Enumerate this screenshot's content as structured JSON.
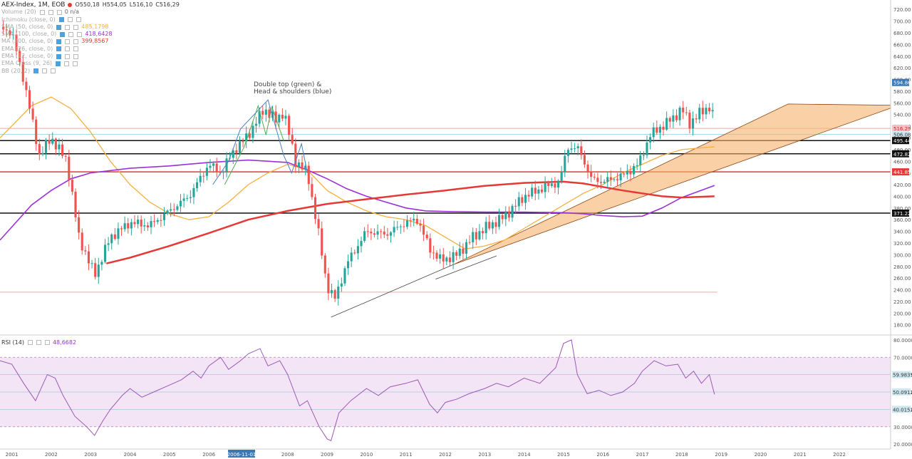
{
  "header": {
    "symbol": "AEX-Index, 1M, EOB",
    "open": "O550,18",
    "high": "H554,05",
    "low": "L516,10",
    "close": "C516,29"
  },
  "indicators": [
    {
      "label": "Volume (20)",
      "value": "0  n/a",
      "color": "#666666"
    },
    {
      "label": "Ichimoku (close, 0)",
      "value": "",
      "color": "#aaaaaa"
    },
    {
      "label": "SMA (50, close, 0)",
      "value": "485,1798",
      "color": "#f5b041"
    },
    {
      "label": "SMA (100, close, 0)",
      "value": "418,6428",
      "color": "#9b30d9"
    },
    {
      "label": "MA (200, close, 0)",
      "value": "399,8567",
      "color": "#e53935"
    },
    {
      "label": "EMA (26, close, 0)",
      "value": "",
      "color": "#aaaaaa"
    },
    {
      "label": "EMA (12, close, 0)",
      "value": "",
      "color": "#aaaaaa"
    },
    {
      "label": "EMA Cross (9, 26)",
      "value": "",
      "color": "#aaaaaa"
    },
    {
      "label": "BB (20, 2)",
      "value": "",
      "color": "#aaaaaa"
    }
  ],
  "annotation": [
    "Double top (green) &",
    "Head & shoulders (blue)"
  ],
  "rsi": {
    "label": "RSI (14)",
    "value": "48,6682"
  },
  "chart_data": {
    "type": "candlestick",
    "price_axis": {
      "ylim": [
        165,
        730
      ],
      "ticks": [
        "720.00",
        "700.00",
        "680.00",
        "660.00",
        "640.00",
        "620.00",
        "600.00",
        "580.00",
        "560.00",
        "540.00",
        "520.00",
        "500.00",
        "480.00",
        "460.00",
        "440.00",
        "420.00",
        "400.00",
        "380.00",
        "360.00",
        "340.00",
        "320.00",
        "300.00",
        "280.00",
        "260.00",
        "240.00",
        "220.00",
        "200.00",
        "180.00"
      ]
    },
    "price_labels": [
      {
        "value": 594.86,
        "text": "594.86",
        "bg": "#3c78b4",
        "fg": "#ffffff"
      },
      {
        "value": 516.29,
        "text": "516.29",
        "bg": "#f3c4c4",
        "fg": "#c62828"
      },
      {
        "value": 506.08,
        "text": "506.08",
        "bg": "#cfe8f0",
        "fg": "#333333"
      },
      {
        "value": 495.44,
        "text": "495.44",
        "bg": "#111111",
        "fg": "#ffffff"
      },
      {
        "value": 472.82,
        "text": "472.82",
        "bg": "#111111",
        "fg": "#ffffff"
      },
      {
        "value": 441.85,
        "text": "441.85",
        "bg": "#e53935",
        "fg": "#ffffff"
      },
      {
        "value": 371.22,
        "text": "371.22",
        "bg": "#111111",
        "fg": "#ffffff"
      }
    ],
    "horizontal_lines": [
      {
        "value": 516.29,
        "color": "#f2a8a8",
        "width": 1
      },
      {
        "value": 506.08,
        "color": "#a8d8e8",
        "width": 1
      },
      {
        "value": 495.44,
        "color": "#111111",
        "width": 1.5
      },
      {
        "value": 472.82,
        "color": "#111111",
        "width": 1.5
      },
      {
        "value": 441.85,
        "color": "#e53935",
        "width": 1.5
      },
      {
        "value": 371.22,
        "color": "#111111",
        "width": 1.5
      },
      {
        "value": 236,
        "color": "#f2a8a8",
        "width": 1
      }
    ],
    "x_axis": {
      "labels": [
        "2001",
        "2002",
        "2003",
        "2004",
        "2005",
        "2006",
        "2007",
        "2008",
        "2009",
        "2010",
        "2011",
        "2012",
        "2013",
        "2014",
        "2015",
        "2016",
        "2017",
        "2018",
        "2019",
        "2020",
        "2021",
        "2022"
      ],
      "range": [
        2000.7,
        2023.3
      ],
      "highlight": {
        "text": "2006-11-01",
        "year": 2006.83
      }
    },
    "close_anchors": [
      [
        2000.7,
        690
      ],
      [
        2001.0,
        680
      ],
      [
        2001.3,
        600
      ],
      [
        2001.7,
        470
      ],
      [
        2002.0,
        500
      ],
      [
        2002.4,
        460
      ],
      [
        2002.7,
        330
      ],
      [
        2003.1,
        265
      ],
      [
        2003.5,
        330
      ],
      [
        2004.0,
        355
      ],
      [
        2004.5,
        350
      ],
      [
        2005.0,
        375
      ],
      [
        2005.5,
        400
      ],
      [
        2006.0,
        455
      ],
      [
        2006.3,
        440
      ],
      [
        2006.6,
        475
      ],
      [
        2007.0,
        505
      ],
      [
        2007.4,
        550
      ],
      [
        2007.7,
        530
      ],
      [
        2007.9,
        545
      ],
      [
        2008.2,
        460
      ],
      [
        2008.5,
        440
      ],
      [
        2008.8,
        330
      ],
      [
        2009.0,
        245
      ],
      [
        2009.2,
        225
      ],
      [
        2009.5,
        285
      ],
      [
        2010.0,
        340
      ],
      [
        2010.5,
        335
      ],
      [
        2011.0,
        355
      ],
      [
        2011.3,
        360
      ],
      [
        2011.6,
        310
      ],
      [
        2011.9,
        290
      ],
      [
        2012.3,
        300
      ],
      [
        2012.7,
        330
      ],
      [
        2013.0,
        345
      ],
      [
        2013.5,
        365
      ],
      [
        2014.0,
        400
      ],
      [
        2014.5,
        415
      ],
      [
        2014.9,
        425
      ],
      [
        2015.1,
        485
      ],
      [
        2015.4,
        480
      ],
      [
        2015.7,
        430
      ],
      [
        2016.0,
        425
      ],
      [
        2016.5,
        435
      ],
      [
        2016.9,
        455
      ],
      [
        2017.2,
        505
      ],
      [
        2017.5,
        520
      ],
      [
        2017.8,
        535
      ],
      [
        2018.0,
        550
      ],
      [
        2018.2,
        525
      ],
      [
        2018.5,
        545
      ],
      [
        2018.75,
        555
      ],
      [
        2018.83,
        516.29
      ]
    ],
    "moving_averages": [
      {
        "name": "SMA 50",
        "color": "#f5b041",
        "width": 1.3,
        "points": [
          [
            2000.7,
            500
          ],
          [
            2001.5,
            555
          ],
          [
            2002.0,
            570
          ],
          [
            2002.5,
            550
          ],
          [
            2003.0,
            510
          ],
          [
            2003.5,
            460
          ],
          [
            2004.0,
            420
          ],
          [
            2004.5,
            390
          ],
          [
            2005.0,
            370
          ],
          [
            2005.5,
            360
          ],
          [
            2006.0,
            365
          ],
          [
            2006.5,
            390
          ],
          [
            2007.0,
            420
          ],
          [
            2007.5,
            440
          ],
          [
            2008.0,
            455
          ],
          [
            2008.5,
            445
          ],
          [
            2009.0,
            410
          ],
          [
            2009.5,
            390
          ],
          [
            2010.0,
            375
          ],
          [
            2010.5,
            365
          ],
          [
            2011.0,
            360
          ],
          [
            2011.5,
            350
          ],
          [
            2012.0,
            330
          ],
          [
            2012.5,
            310
          ],
          [
            2013.0,
            315
          ],
          [
            2013.5,
            325
          ],
          [
            2014.0,
            345
          ],
          [
            2014.5,
            365
          ],
          [
            2015.0,
            385
          ],
          [
            2015.5,
            405
          ],
          [
            2016.0,
            420
          ],
          [
            2016.5,
            440
          ],
          [
            2017.0,
            455
          ],
          [
            2017.5,
            470
          ],
          [
            2018.0,
            480
          ],
          [
            2018.83,
            485
          ]
        ]
      },
      {
        "name": "SMA 100",
        "color": "#9b30d9",
        "width": 1.6,
        "points": [
          [
            2000.7,
            325
          ],
          [
            2001.5,
            385
          ],
          [
            2002.0,
            410
          ],
          [
            2002.5,
            430
          ],
          [
            2003.0,
            440
          ],
          [
            2004.0,
            448
          ],
          [
            2005.0,
            452
          ],
          [
            2006.0,
            458
          ],
          [
            2007.0,
            462
          ],
          [
            2008.0,
            458
          ],
          [
            2008.5,
            445
          ],
          [
            2009.0,
            430
          ],
          [
            2009.5,
            413
          ],
          [
            2010.0,
            400
          ],
          [
            2010.5,
            390
          ],
          [
            2011.0,
            380
          ],
          [
            2011.5,
            375
          ],
          [
            2012.0,
            374
          ],
          [
            2013.0,
            373
          ],
          [
            2014.0,
            373
          ],
          [
            2015.0,
            372
          ],
          [
            2015.5,
            370
          ],
          [
            2016.0,
            367
          ],
          [
            2016.5,
            365
          ],
          [
            2017.0,
            366
          ],
          [
            2017.5,
            380
          ],
          [
            2018.0,
            398
          ],
          [
            2018.83,
            418.6
          ]
        ]
      },
      {
        "name": "MA 200",
        "color": "#e53935",
        "width": 2.5,
        "points": [
          [
            2003.4,
            285
          ],
          [
            2004.0,
            295
          ],
          [
            2005.0,
            315
          ],
          [
            2006.0,
            337
          ],
          [
            2007.0,
            360
          ],
          [
            2008.0,
            375
          ],
          [
            2009.0,
            387
          ],
          [
            2010.0,
            395
          ],
          [
            2011.0,
            403
          ],
          [
            2012.0,
            410
          ],
          [
            2013.0,
            418
          ],
          [
            2014.0,
            423
          ],
          [
            2015.0,
            425
          ],
          [
            2015.5,
            422
          ],
          [
            2016.0,
            416
          ],
          [
            2016.5,
            410
          ],
          [
            2017.0,
            405
          ],
          [
            2017.5,
            400
          ],
          [
            2018.0,
            398
          ],
          [
            2018.83,
            400
          ]
        ]
      }
    ],
    "trendlines": [
      {
        "color": "#444444",
        "from": [
          2009.1,
          193
        ],
        "to": [
          2012.2,
          283
        ]
      },
      {
        "color": "#444444",
        "from": [
          2011.75,
          258
        ],
        "to": [
          2013.3,
          298
        ]
      }
    ],
    "pattern_green": [
      [
        2006.4,
        420
      ],
      [
        2006.9,
        485
      ],
      [
        2007.25,
        555
      ],
      [
        2007.45,
        505
      ],
      [
        2007.6,
        553
      ],
      [
        2007.9,
        495
      ]
    ],
    "pattern_blue": [
      [
        2006.1,
        420
      ],
      [
        2006.5,
        460
      ],
      [
        2006.8,
        515
      ],
      [
        2007.5,
        565
      ],
      [
        2007.9,
        470
      ],
      [
        2008.1,
        440
      ],
      [
        2008.35,
        490
      ],
      [
        2008.5,
        440
      ]
    ],
    "channel": {
      "fill": "#f6b26b",
      "stroke": "#8b4513",
      "upper": [
        [
          2012.2,
          283
        ],
        [
          2020.7,
          558
        ],
        [
          2023.3,
          556
        ]
      ],
      "lower": [
        [
          2023.3,
          551
        ],
        [
          2016.2,
          380
        ],
        [
          2012.2,
          283
        ]
      ]
    },
    "rsi_panel": {
      "ylim": [
        18,
        82
      ],
      "ticks": [
        "80.0000",
        "70.0000",
        "60.0000",
        "50.0000",
        "40.0000",
        "30.0000",
        "20.0000"
      ],
      "bands": {
        "upper": 70,
        "lower": 30
      },
      "labels": [
        {
          "value": 59.9835,
          "text": "59.9835",
          "bg": "#cfe8f0"
        },
        {
          "value": 50.0912,
          "text": "50.0912",
          "bg": "#cfe8f0"
        },
        {
          "value": 40.0152,
          "text": "40.0152",
          "bg": "#cfe8f0"
        }
      ],
      "series": [
        [
          2000.7,
          68
        ],
        [
          2001.0,
          66
        ],
        [
          2001.3,
          55
        ],
        [
          2001.6,
          45
        ],
        [
          2001.9,
          60
        ],
        [
          2002.1,
          58
        ],
        [
          2002.3,
          48
        ],
        [
          2002.6,
          36
        ],
        [
          2002.9,
          30
        ],
        [
          2003.1,
          25
        ],
        [
          2003.3,
          33
        ],
        [
          2003.5,
          40
        ],
        [
          2003.8,
          48
        ],
        [
          2004.0,
          52
        ],
        [
          2004.3,
          47
        ],
        [
          2004.6,
          50
        ],
        [
          2005.0,
          54
        ],
        [
          2005.3,
          57
        ],
        [
          2005.6,
          62
        ],
        [
          2005.8,
          58
        ],
        [
          2006.0,
          65
        ],
        [
          2006.3,
          70
        ],
        [
          2006.5,
          63
        ],
        [
          2006.8,
          68
        ],
        [
          2007.0,
          72
        ],
        [
          2007.3,
          75
        ],
        [
          2007.5,
          65
        ],
        [
          2007.8,
          68
        ],
        [
          2008.0,
          60
        ],
        [
          2008.3,
          42
        ],
        [
          2008.5,
          45
        ],
        [
          2008.8,
          30
        ],
        [
          2009.0,
          23
        ],
        [
          2009.1,
          22
        ],
        [
          2009.3,
          38
        ],
        [
          2009.6,
          45
        ],
        [
          2010.0,
          52
        ],
        [
          2010.3,
          48
        ],
        [
          2010.6,
          53
        ],
        [
          2011.0,
          55
        ],
        [
          2011.3,
          57
        ],
        [
          2011.6,
          43
        ],
        [
          2011.8,
          38
        ],
        [
          2012.0,
          44
        ],
        [
          2012.3,
          46
        ],
        [
          2012.6,
          49
        ],
        [
          2013.0,
          52
        ],
        [
          2013.3,
          55
        ],
        [
          2013.6,
          53
        ],
        [
          2014.0,
          58
        ],
        [
          2014.4,
          55
        ],
        [
          2014.8,
          64
        ],
        [
          2015.0,
          78
        ],
        [
          2015.2,
          80
        ],
        [
          2015.35,
          60
        ],
        [
          2015.6,
          49
        ],
        [
          2015.9,
          51
        ],
        [
          2016.2,
          48
        ],
        [
          2016.5,
          50
        ],
        [
          2016.8,
          55
        ],
        [
          2017.0,
          62
        ],
        [
          2017.3,
          68
        ],
        [
          2017.6,
          65
        ],
        [
          2017.9,
          66
        ],
        [
          2018.1,
          58
        ],
        [
          2018.3,
          62
        ],
        [
          2018.5,
          55
        ],
        [
          2018.7,
          60
        ],
        [
          2018.83,
          48.67
        ]
      ]
    }
  }
}
